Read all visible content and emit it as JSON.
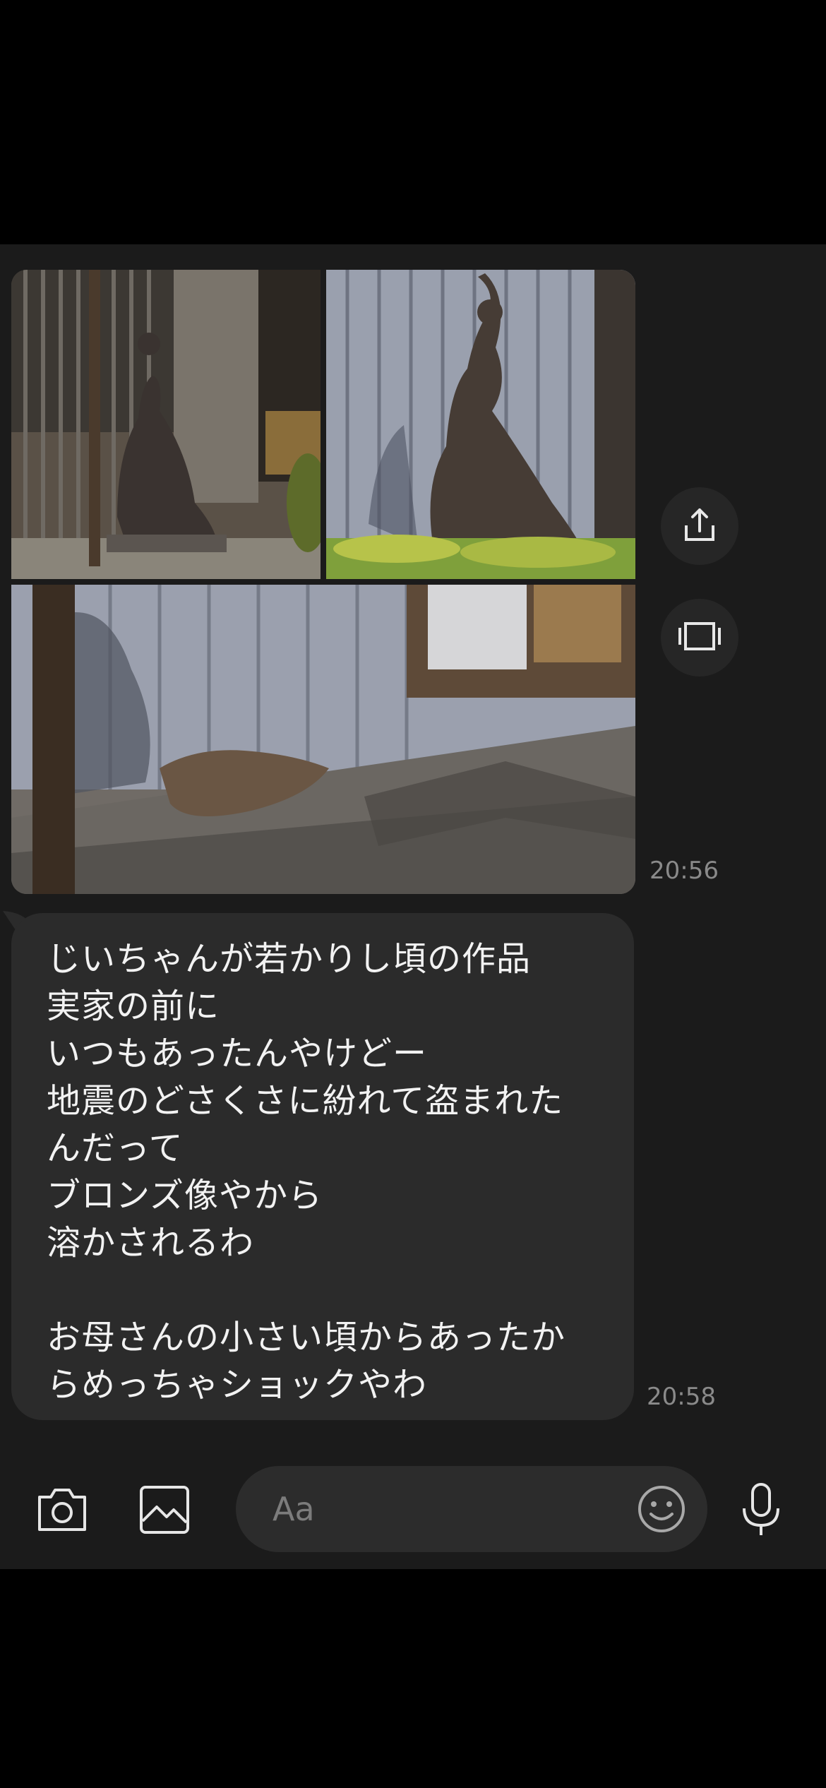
{
  "images": {
    "share_icon": "share-icon",
    "gallery_icon": "gallery-view-icon",
    "time": "20:56"
  },
  "message": {
    "lines": [
      "じいちゃんが若かりし頃の作品",
      "実家の前に",
      "いつもあったんやけどー",
      "地震のどさくさに紛れて盗まれた",
      "んだって",
      "ブロンズ像やから",
      "溶かされるわ",
      "",
      "お母さんの小さい頃からあったか",
      "らめっちゃショックやわ"
    ],
    "time": "20:58"
  },
  "toolbar": {
    "camera_icon": "camera-icon",
    "image_icon": "image-icon",
    "input_placeholder": "Aa",
    "emoji_icon": "emoji-icon",
    "mic_icon": "microphone-icon"
  },
  "colors": {
    "chat_background": "#1b1b1b",
    "bubble": "#2b2b2b",
    "timestamp": "#8a8a8a"
  }
}
